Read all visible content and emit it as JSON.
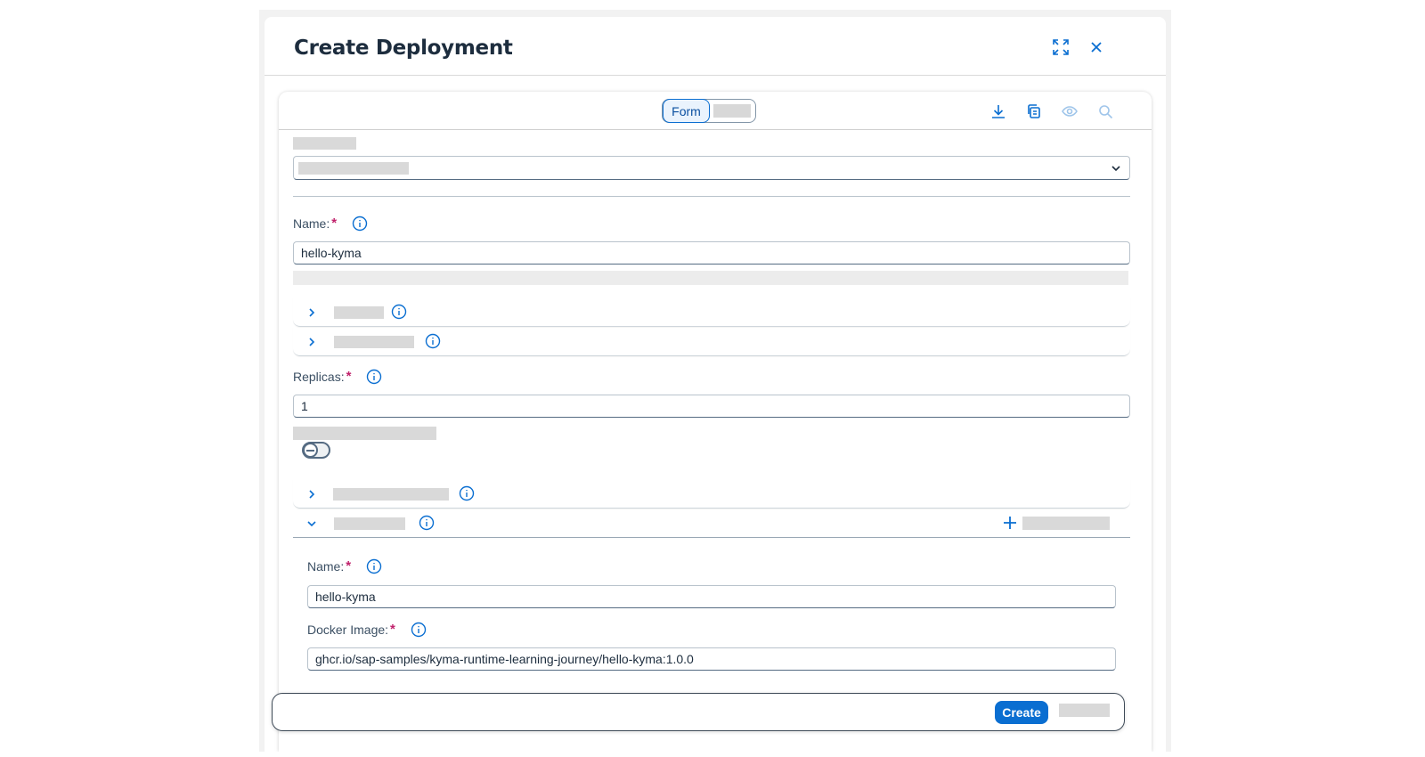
{
  "dialog": {
    "title": "Create Deployment",
    "icons": {
      "expand": "expand-icon",
      "close": "close-icon"
    }
  },
  "toolbar": {
    "mode_selected": "Form",
    "icons": [
      "download-icon",
      "copy-icon",
      "eye-icon",
      "search-icon"
    ]
  },
  "form": {
    "name_label": "Name:",
    "name_value": "hello-kyma",
    "replicas_label": "Replicas:",
    "replicas_value": "1",
    "containers": {
      "name_label": "Name:",
      "name_value": "hello-kyma",
      "docker_image_label": "Docker Image:",
      "docker_image_value": "ghcr.io/sap-samples/kyma-runtime-learning-journey/hello-kyma:1.0.0"
    },
    "required_mark": "*"
  },
  "footer": {
    "create_label": "Create"
  },
  "colors": {
    "accent": "#0a6ed1",
    "required": "#c0216b",
    "title": "#1d2d3e"
  }
}
